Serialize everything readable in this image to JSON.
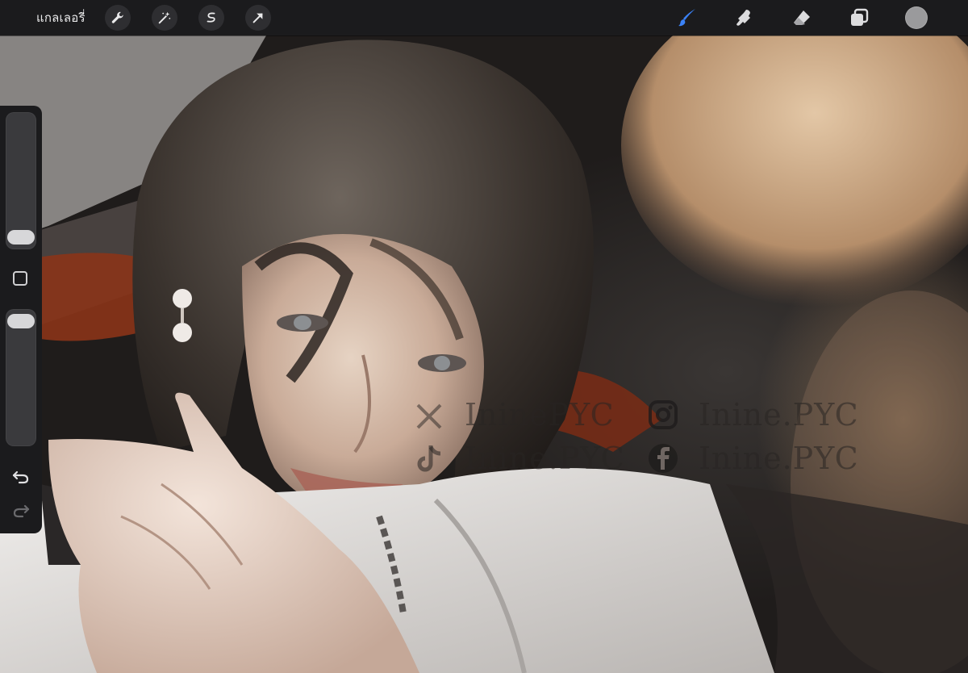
{
  "topbar": {
    "gallery_label": "แกลเลอรี่",
    "tools_left": [
      "wrench-icon",
      "magic-wand-icon",
      "selection-icon",
      "transform-arrow-icon"
    ],
    "tools_right": [
      "brush-icon",
      "smudge-icon",
      "eraser-icon",
      "layers-icon",
      "color-swatch"
    ],
    "active_tool": "brush",
    "accent_color": "#3b82f6",
    "current_color": "#9a9a9c"
  },
  "sidebar": {
    "controls": [
      "brush-size-slider",
      "modify-button",
      "opacity-slider",
      "undo-icon",
      "redo-icon"
    ]
  },
  "watermark": {
    "x_handle": "IninePYC",
    "instagram_handle": "Inine.PYC",
    "tiktok_handle": "Inine.PYC",
    "facebook_handle": "Inine.PYC"
  }
}
